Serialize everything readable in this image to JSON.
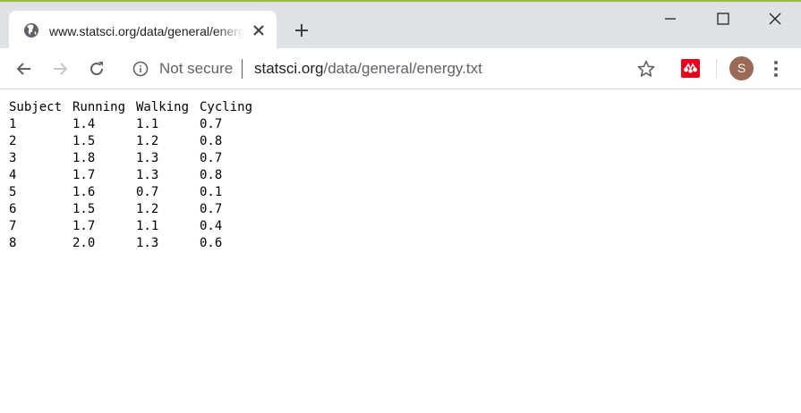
{
  "browser": {
    "tab": {
      "title": "www.statsci.org/data/general/energy.txt",
      "favicon_icon": "globe-icon",
      "close_icon": "close-icon"
    },
    "new_tab_icon": "plus-icon",
    "window_controls": [
      "minimize-icon",
      "maximize-icon",
      "close-icon"
    ],
    "toolbar": {
      "back_icon": "arrow-left-icon",
      "forward_icon": "arrow-right-icon",
      "reload_icon": "reload-icon",
      "security_text": "Not secure",
      "url_host": "statsci.org",
      "url_path": "/data/general/energy.txt",
      "bookmark_icon": "star-icon",
      "extension_icon": "mendeley-icon",
      "avatar_letter": "S",
      "menu_icon": "more-vert-icon"
    }
  },
  "page": {
    "columns": [
      "Subject",
      "Running",
      "Walking",
      "Cycling"
    ],
    "rows": [
      [
        "1",
        "1.4",
        "1.1",
        "0.7"
      ],
      [
        "2",
        "1.5",
        "1.2",
        "0.8"
      ],
      [
        "3",
        "1.8",
        "1.3",
        "0.7"
      ],
      [
        "4",
        "1.7",
        "1.3",
        "0.8"
      ],
      [
        "5",
        "1.6",
        "0.7",
        "0.1"
      ],
      [
        "6",
        "1.5",
        "1.2",
        "0.7"
      ],
      [
        "7",
        "1.7",
        "1.1",
        "0.4"
      ],
      [
        "8",
        "2.0",
        "1.3",
        "0.6"
      ]
    ]
  },
  "colors": {
    "tabstrip": "#dee1e6",
    "accent_top": "#9bbb3a",
    "extension": "#e8001c",
    "avatar": "#9a6a55"
  }
}
